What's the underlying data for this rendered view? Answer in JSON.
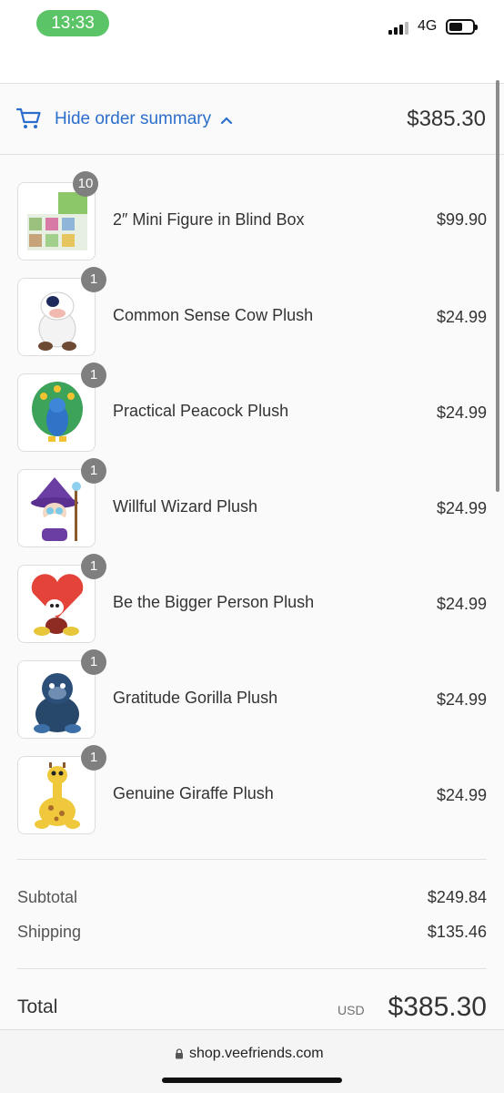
{
  "status_bar": {
    "time": "13:33",
    "network": "4G"
  },
  "summary_toggle": {
    "label": "Hide order summary",
    "total": "$385.30"
  },
  "products": [
    {
      "name": "2″ Mini Figure in Blind Box",
      "price": "$99.90",
      "quantity": "10"
    },
    {
      "name": "Common Sense Cow Plush",
      "price": "$24.99",
      "quantity": "1"
    },
    {
      "name": "Practical Peacock Plush",
      "price": "$24.99",
      "quantity": "1"
    },
    {
      "name": "Willful Wizard Plush",
      "price": "$24.99",
      "quantity": "1"
    },
    {
      "name": "Be the Bigger Person Plush",
      "price": "$24.99",
      "quantity": "1"
    },
    {
      "name": "Gratitude Gorilla Plush",
      "price": "$24.99",
      "quantity": "1"
    },
    {
      "name": "Genuine Giraffe Plush",
      "price": "$24.99",
      "quantity": "1"
    }
  ],
  "totals": {
    "subtotal_label": "Subtotal",
    "subtotal": "$249.84",
    "shipping_label": "Shipping",
    "shipping": "$135.46",
    "total_label": "Total",
    "currency": "USD",
    "total": "$385.30"
  },
  "browser": {
    "url": "shop.veefriends.com"
  },
  "colors": {
    "accent": "#2c6ecb",
    "time_pill": "#5ac466",
    "badge": "#7f7f7f"
  }
}
